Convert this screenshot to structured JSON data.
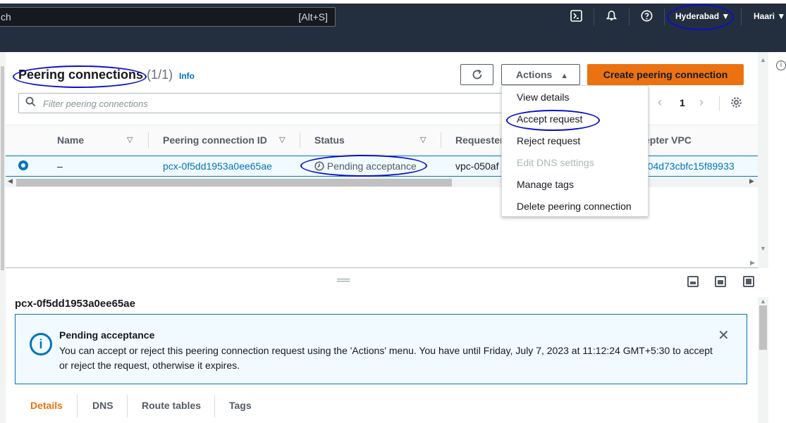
{
  "topbar": {
    "search_placeholder": "ch",
    "search_shortcut": "[Alt+S]",
    "region": "Hyderabad ▼",
    "user": "Haari ▼"
  },
  "icons": {
    "cloudshell": "cloudshell-icon",
    "notifications": "bell-icon",
    "help": "help-icon"
  },
  "page": {
    "title": "Peering connections",
    "count": "(1/1)",
    "info": "Info",
    "actions_label": "Actions",
    "create_label": "Create peering connection",
    "filter_placeholder": "Filter peering connections",
    "page_number": "1"
  },
  "table": {
    "headers": [
      "Name",
      "Peering connection ID",
      "Status",
      "Requester",
      "epter VPC"
    ],
    "row": {
      "name": "–",
      "id": "pcx-0f5dd1953a0ee65ae",
      "status": "Pending acceptance",
      "requester": "vpc-050af",
      "accepter": "-04d73cbfc15f89933"
    }
  },
  "dropdown": {
    "items": [
      {
        "label": "View details",
        "disabled": false
      },
      {
        "label": "Accept request",
        "disabled": false
      },
      {
        "label": "Reject request",
        "disabled": false
      },
      {
        "label": "Edit DNS settings",
        "disabled": true
      },
      {
        "label": "Manage tags",
        "disabled": false
      },
      {
        "label": "Delete peering connection",
        "disabled": false
      }
    ]
  },
  "details": {
    "title": "pcx-0f5dd1953a0ee65ae",
    "alert_title": "Pending acceptance",
    "alert_text": "You can accept or reject this peering connection request using the 'Actions' menu. You have until Friday, July 7, 2023 at 11:12:24 GMT+5:30 to accept or reject the request, otherwise it expires.",
    "tabs": [
      "Details",
      "DNS",
      "Route tables",
      "Tags"
    ]
  },
  "colors": {
    "accent": "#0073bb",
    "primary_button": "#ec7211",
    "active_tab": "#ec7211",
    "annotation": "#0a10c8"
  }
}
